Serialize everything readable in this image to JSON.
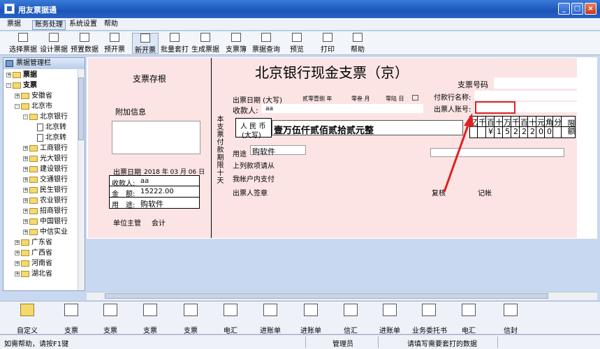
{
  "window": {
    "title": "用友票据通"
  },
  "menu": [
    "票据",
    "账务处理",
    "系统设置",
    "帮助"
  ],
  "toolbar": [
    "选择票据",
    "设计票据",
    "预置数据",
    "预开票",
    "新开票",
    "批量套打",
    "生成票据",
    "支票簿",
    "票据查询",
    "预览",
    "打印",
    "帮助"
  ],
  "left_panel": {
    "title": "票据管理栏",
    "tree": [
      {
        "label": "票据",
        "type": "root",
        "expander": "+"
      },
      {
        "label": "支票",
        "type": "root",
        "expander": "-"
      },
      {
        "label": "安徽省",
        "type": "folder",
        "expander": "+"
      },
      {
        "label": "北京市",
        "type": "folder",
        "expander": "-"
      },
      {
        "label": "北京银行",
        "type": "folder",
        "expander": "-"
      },
      {
        "label": "北京转",
        "type": "doc",
        "expander": ""
      },
      {
        "label": "北京转",
        "type": "doc",
        "expander": ""
      },
      {
        "label": "工商银行",
        "type": "folder",
        "expander": "+"
      },
      {
        "label": "光大银行",
        "type": "folder",
        "expander": "+"
      },
      {
        "label": "建设银行",
        "type": "folder",
        "expander": "+"
      },
      {
        "label": "交通银行",
        "type": "folder",
        "expander": "+"
      },
      {
        "label": "民生银行",
        "type": "folder",
        "expander": "+"
      },
      {
        "label": "农业银行",
        "type": "folder",
        "expander": "+"
      },
      {
        "label": "招商银行",
        "type": "folder",
        "expander": "+"
      },
      {
        "label": "中国银行",
        "type": "folder",
        "expander": "+"
      },
      {
        "label": "中信实业",
        "type": "folder",
        "expander": "+"
      },
      {
        "label": "广东省",
        "type": "folder",
        "expander": "+"
      },
      {
        "label": "广西省",
        "type": "folder",
        "expander": "+"
      },
      {
        "label": "河南省",
        "type": "folder",
        "expander": "+"
      },
      {
        "label": "湖北省",
        "type": "folder",
        "expander": "+"
      }
    ]
  },
  "stub": {
    "title": "支票存根",
    "extra_label": "附加信息",
    "date_label": "出票日期",
    "date_value": "2018 年 03 月 06 日",
    "payee_label": "收款人:",
    "payee_value": "aa",
    "amount_label": "金　额:",
    "amount_value": "15222.00",
    "purpose_label": "用　途:",
    "purpose_value": "购软件",
    "manager_label": "单位主管",
    "accountant_label": "会计"
  },
  "cheque": {
    "title": "北京银行现金支票（京）",
    "check_no_label": "支票号码",
    "date_label": "出票日期 (大写)",
    "date_year": "贰零壹捌 年",
    "date_month": "零叁 月",
    "date_day": "零陆 日",
    "payer_bank_label": "付款行名称:",
    "payee_label": "收款人:",
    "payee_value": "aa",
    "account_label": "出票人账号:",
    "vertical_text": "本支票付款期限十天",
    "currency_label_1": "人 民 币",
    "currency_label_2": "(大写)",
    "amount_words": "壹万伍仟贰佰贰拾贰元整",
    "digit_headers": [
      "亿",
      "千",
      "百",
      "十",
      "万",
      "千",
      "百",
      "十",
      "元",
      "角",
      "分"
    ],
    "digit_values": [
      "",
      "",
      "¥",
      "1",
      "5",
      "2",
      "2",
      "2",
      "0",
      "0",
      ""
    ],
    "limit_label": "限额",
    "purpose_label": "用途",
    "purpose_value": "购软件",
    "above_label": "上列款项请从",
    "account_pay_label": "我帐户内支付",
    "signature_label": "出票人签章",
    "review_label": "复核",
    "book_label": "记帐"
  },
  "bottom_toolbar": [
    "自定义",
    "支票",
    "支票",
    "支票",
    "支票",
    "电汇",
    "进账单",
    "进账单",
    "信汇",
    "进账单",
    "业务委托书",
    "电汇",
    "信封"
  ],
  "status": {
    "help": "如需帮助，请按F1键",
    "user": "管理员",
    "hint": "请填写需要套打的数据"
  },
  "colors": {
    "cheque_bg": "#fce4e4",
    "highlight": "#e02020",
    "window_blue": "#2a62c4"
  }
}
